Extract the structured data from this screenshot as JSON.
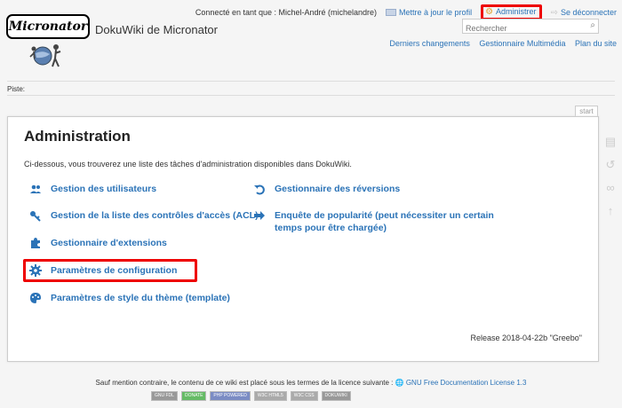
{
  "header": {
    "logged_in_text": "Connecté en tant que : Michel-André (michelandre)",
    "profile_link": "Mettre à jour le profil",
    "admin_link": "Administrer",
    "logout_link": "Se déconnecter",
    "logo_text": "Micronator",
    "site_title": "DokuWiki de Micronator",
    "search_placeholder": "Rechercher",
    "site_tools": [
      "Derniers changements",
      "Gestionnaire Multimédia",
      "Plan du site"
    ]
  },
  "breadcrumb": {
    "label": "Piste:"
  },
  "page": {
    "tab": "start",
    "title": "Administration",
    "intro": "Ci-dessous, vous trouverez une liste des tâches d'administration disponibles dans DokuWiki.",
    "left_items": [
      "Gestion des utilisateurs",
      "Gestion de la liste des contrôles d'accès (ACL)",
      "Gestionnaire d'extensions",
      "Paramètres de configuration",
      "Paramètres de style du thème (template)"
    ],
    "right_items": [
      "Gestionnaire des réversions",
      "Enquête de popularité (peut nécessiter un certain temps pour être chargée)"
    ],
    "release": "Release 2018-04-22b \"Greebo\""
  },
  "footer": {
    "license_prefix": "Sauf mention contraire, le contenu de ce wiki est placé sous les termes de la licence suivante :",
    "license_link": "GNU Free Documentation License 1.3",
    "badges": [
      "GNU FDL",
      "DONATE",
      "PHP POWERED",
      "W3C HTML5",
      "W3C CSS",
      "DOKUWIKI"
    ]
  },
  "colors": {
    "link": "#2b73b7",
    "highlight": "#e00000"
  }
}
